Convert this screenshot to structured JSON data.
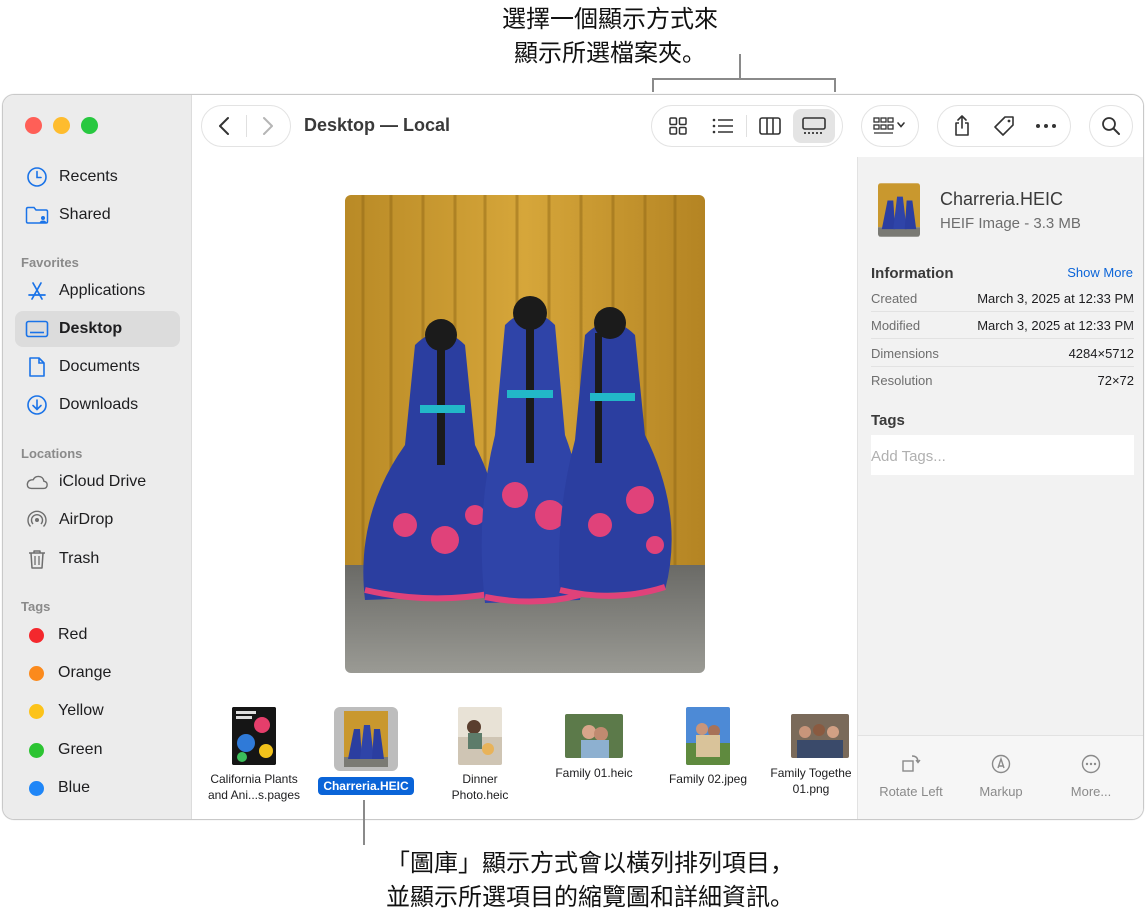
{
  "callouts": {
    "top_line1": "選擇一個顯示方式來",
    "top_line2": "顯示所選檔案夾。",
    "bottom_line1": "「圖庫」顯示方式會以橫列排列項目，",
    "bottom_line2": "並顯示所選項目的縮覽圖和詳細資訊。"
  },
  "toolbar": {
    "title": "Desktop — Local",
    "icons": [
      "chevron-left-icon",
      "chevron-right-icon",
      "icon-view-icon",
      "list-view-icon",
      "column-view-icon",
      "gallery-view-icon",
      "group-icon",
      "share-icon",
      "tag-icon",
      "more-icon",
      "search-icon"
    ]
  },
  "sidebar": {
    "favorites_header": "Favorites",
    "locations_header": "Locations",
    "tags_header": "Tags",
    "top_items": [
      {
        "label": "Recents",
        "icon": "clock-icon"
      },
      {
        "label": "Shared",
        "icon": "shared-folder-icon"
      }
    ],
    "favorites": [
      {
        "label": "Applications",
        "icon": "applications-icon"
      },
      {
        "label": "Desktop",
        "icon": "desktop-icon",
        "selected": true
      },
      {
        "label": "Documents",
        "icon": "document-icon"
      },
      {
        "label": "Downloads",
        "icon": "download-icon"
      }
    ],
    "locations": [
      {
        "label": "iCloud Drive",
        "icon": "cloud-icon"
      },
      {
        "label": "AirDrop",
        "icon": "airdrop-icon"
      },
      {
        "label": "Trash",
        "icon": "trash-icon"
      }
    ],
    "tags": [
      {
        "label": "Red",
        "color": "#f4282d"
      },
      {
        "label": "Orange",
        "color": "#fb8a1c"
      },
      {
        "label": "Yellow",
        "color": "#fcc31a"
      },
      {
        "label": "Green",
        "color": "#2cc432"
      },
      {
        "label": "Blue",
        "color": "#1f86f7"
      }
    ]
  },
  "gallery": {
    "items": [
      {
        "line1": "California Plants",
        "line2": "and Ani...s.pages"
      },
      {
        "line1": "Charreria.HEIC",
        "line2": "",
        "selected": true
      },
      {
        "line1": "Dinner",
        "line2": "Photo.heic"
      },
      {
        "line1": "Family 01.heic",
        "line2": ""
      },
      {
        "line1": "Family 02.jpeg",
        "line2": ""
      },
      {
        "line1": "Family Togethe",
        "line2": "01.png"
      }
    ]
  },
  "inspector": {
    "file_name": "Charreria.HEIC",
    "file_kind": "HEIF Image - 3.3 MB",
    "information_heading": "Information",
    "show_more": "Show More",
    "rows": [
      {
        "label": "Created",
        "value": "March 3, 2025 at 12:33 PM"
      },
      {
        "label": "Modified",
        "value": "March 3, 2025 at 12:33 PM"
      },
      {
        "label": "Dimensions",
        "value": "4284×5712"
      },
      {
        "label": "Resolution",
        "value": "72×72"
      }
    ],
    "tags_heading": "Tags",
    "tags_placeholder": "Add Tags...",
    "actions": [
      {
        "label": "Rotate Left",
        "icon": "rotate-left-icon"
      },
      {
        "label": "Markup",
        "icon": "markup-icon"
      },
      {
        "label": "More...",
        "icon": "more-circle-icon"
      }
    ]
  },
  "colors": {
    "accent": "#0a64d8",
    "sidebar_bg": "#ececec",
    "inspector_bg": "#f2f2f2"
  }
}
